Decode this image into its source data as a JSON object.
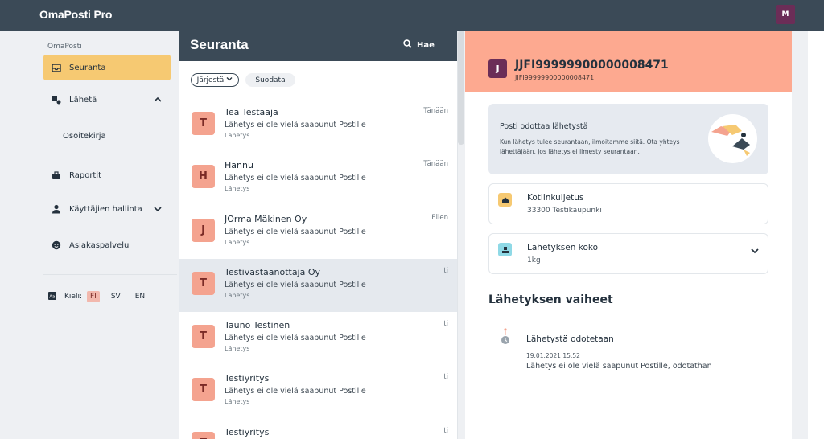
{
  "app": {
    "title": "OmaPosti Pro",
    "user_initial": "M"
  },
  "sidebar": {
    "section_label": "OmaPosti",
    "items": [
      {
        "label": "Seuranta",
        "icon": "inbox-icon",
        "active": true
      },
      {
        "label": "Lähetä",
        "icon": "send-package-icon",
        "expanded": true
      },
      {
        "label": "Osoitekirja",
        "sub": true
      },
      {
        "label": "Raportit",
        "icon": "briefcase-icon"
      },
      {
        "label": "Käyttäjien hallinta",
        "icon": "user-icon"
      },
      {
        "label": "Asiakaspalvelu",
        "icon": "smiley-icon"
      }
    ],
    "language": {
      "label": "Kieli:",
      "options": [
        "FI",
        "SV",
        "EN"
      ],
      "selected": "FI"
    }
  },
  "list": {
    "title": "Seuranta",
    "search_label": "Hae",
    "sort_label": "Järjestä",
    "filter_label": "Suodata",
    "rows": [
      {
        "initial": "T",
        "name": "Tea Testaaja",
        "status": "Lähetys ei ole vielä saapunut Postille",
        "type": "Lähetys",
        "date": "Tänään"
      },
      {
        "initial": "H",
        "name": "Hannu",
        "status": "Lähetys ei ole vielä saapunut Postille",
        "type": "Lähetys",
        "date": "Tänään"
      },
      {
        "initial": "J",
        "name": "JOrma Mäkinen Oy",
        "status": "Lähetys ei ole vielä saapunut Postille",
        "type": "Lähetys",
        "date": "Eilen"
      },
      {
        "initial": "T",
        "name": "Testivastaanottaja Oy",
        "status": "Lähetys ei ole vielä saapunut Postille",
        "type": "Lähetys",
        "date": "ti",
        "selected": true
      },
      {
        "initial": "T",
        "name": "Tauno Testinen",
        "status": "Lähetys ei ole vielä saapunut Postille",
        "type": "Lähetys",
        "date": "ti"
      },
      {
        "initial": "T",
        "name": "Testiyritys",
        "status": "Lähetys ei ole vielä saapunut Postille",
        "type": "Lähetys",
        "date": "ti"
      },
      {
        "initial": "T",
        "name": "Testiyritys",
        "status": "",
        "type": "",
        "date": "ti"
      }
    ]
  },
  "detail": {
    "initial": "J",
    "tracking_id": "JJFI99999900000008471",
    "tracking_sub": "JJFI99999900000008471",
    "info_title": "Posti odottaa lähetystä",
    "info_text": "Kun lähetys tulee seurantaan, ilmoitamme siitä. Ota yhteys lähettäjään, jos lähetys ei ilmesty seurantaan.",
    "delivery_title": "Kotiinkuljetus",
    "delivery_sub": "33300 Testikaupunki",
    "size_title": "Lähetyksen koko",
    "size_sub": "1kg",
    "phases_title": "Lähetyksen vaiheet",
    "step_title": "Lähetystä odotetaan",
    "step_date": "19.01.2021 15:52",
    "step_desc": "Lähetys ei ole vielä saapunut Postille, odotathan"
  },
  "colors": {
    "header": "#3b4a57",
    "accent": "#f6c972",
    "salmon": "#fda990",
    "avatar_bg": "#f4a38f",
    "brand_purple": "#6b2d57"
  }
}
